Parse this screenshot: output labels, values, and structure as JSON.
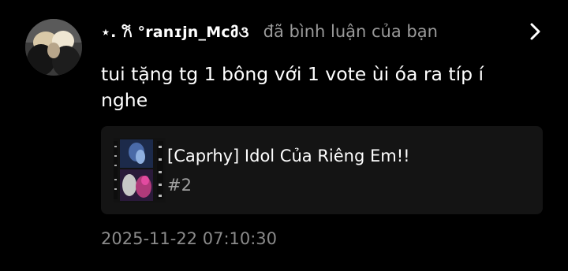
{
  "notification": {
    "username": "⋆. 𐙚 °ranɪjn_Mcმ૩",
    "action_text": "đã bình luận của bạn",
    "comment": "tui tặng tg 1 bông với 1 vote ùi óa ra típ í nghe",
    "story": {
      "title": "[Caprhy] Idol Của Riêng Em!!",
      "chapter": "#2"
    },
    "timestamp": "2025-11-22 07:10:30"
  },
  "icons": {
    "avatar": "avatar-photo",
    "chevron": "chevron-right-icon",
    "cover": "story-cover-thumbnail"
  },
  "colors": {
    "background": "#000000",
    "card_background": "#141414",
    "primary_text": "#ffffff",
    "secondary_text": "#9a9a9a",
    "timestamp_text": "#8a8a8a"
  }
}
